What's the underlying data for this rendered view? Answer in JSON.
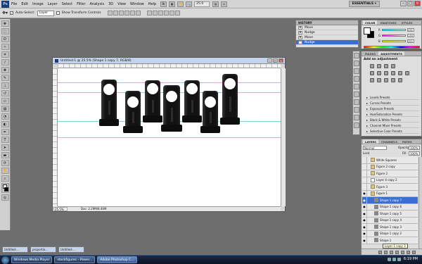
{
  "menubar": {
    "logo": "Ps",
    "items": [
      "File",
      "Edit",
      "Image",
      "Layer",
      "Select",
      "Filter",
      "Analysis",
      "3D",
      "View",
      "Window",
      "Help"
    ],
    "zoom": "25.0",
    "workspace": "ESSENTIALS ▾"
  },
  "options": {
    "auto_select_label": "Auto-Select:",
    "auto_select_value": "Layer",
    "transform_label": "Show Transform Controls"
  },
  "document": {
    "title": "Untitled-1 @ 25.5% (Shape 1 copy 7, RGB/8)",
    "zoom": "25.5%",
    "doc_size": "Doc: 2.29M/8.46M"
  },
  "history": {
    "tab": "HISTORY",
    "items": [
      "Move",
      "Nudge",
      "Move",
      "Nudge"
    ],
    "selected_index": 3
  },
  "color_panel": {
    "tabs": [
      "COLOR",
      "SWATCHES",
      "STYLES"
    ],
    "r_label": "R",
    "g_label": "G",
    "b_label": "B",
    "r": "255",
    "g": "255",
    "b": "255",
    "fg": "#ffffff",
    "bg": "#000000"
  },
  "adjustments": {
    "tabs": [
      "MASKS",
      "ADJUSTMENTS"
    ],
    "title": "Add an adjustment",
    "presets": [
      "Levels Presets",
      "Curves Presets",
      "Exposure Presets",
      "Hue/Saturation Presets",
      "Black & White Presets",
      "Channel Mixer Presets",
      "Selective Color Presets"
    ]
  },
  "layers": {
    "tabs": [
      "LAYERS",
      "CHANNELS",
      "PATHS"
    ],
    "blend_mode": "Normal",
    "opacity_label": "Opacity:",
    "opacity": "100%",
    "lock_label": "Lock:",
    "fill_label": "Fill:",
    "fill": "100%",
    "rows": [
      {
        "name": "White Squares",
        "kind": "group",
        "visible": false,
        "indent": false
      },
      {
        "name": "Figure 2 copy",
        "kind": "group",
        "visible": false,
        "indent": false
      },
      {
        "name": "Figure 2",
        "kind": "group",
        "visible": false,
        "indent": false
      },
      {
        "name": "Layer 4 copy 2",
        "kind": "layer",
        "visible": false,
        "indent": false
      },
      {
        "name": "Figure 3",
        "kind": "group",
        "visible": false,
        "indent": false
      },
      {
        "name": "Figure 1",
        "kind": "group",
        "visible": true,
        "indent": false
      },
      {
        "name": "Shape 1 copy 7",
        "kind": "shape",
        "visible": true,
        "indent": true,
        "selected": true
      },
      {
        "name": "Shape 1 copy 6",
        "kind": "shape",
        "visible": true,
        "indent": true
      },
      {
        "name": "Shape 1 copy 5",
        "kind": "shape",
        "visible": true,
        "indent": true
      },
      {
        "name": "Shape 1 copy 4",
        "kind": "shape",
        "visible": true,
        "indent": true
      },
      {
        "name": "Shape 1 copy 3",
        "kind": "shape",
        "visible": true,
        "indent": true
      },
      {
        "name": "Shape 1 copy 2",
        "kind": "shape",
        "visible": true,
        "indent": true
      },
      {
        "name": "Shape 1",
        "kind": "shape",
        "visible": true,
        "indent": true
      }
    ],
    "tooltip": "Layer 1 copy 3"
  },
  "minimized_docs": [
    "Untitled-...",
    "proportio...",
    "Untitled-..."
  ],
  "taskbar": {
    "tasks": [
      "Windows Media Player",
      "stockfigures – Power...",
      "Adobe Photoshop C..."
    ],
    "active_index": 2,
    "clock": "6:19 PM"
  }
}
